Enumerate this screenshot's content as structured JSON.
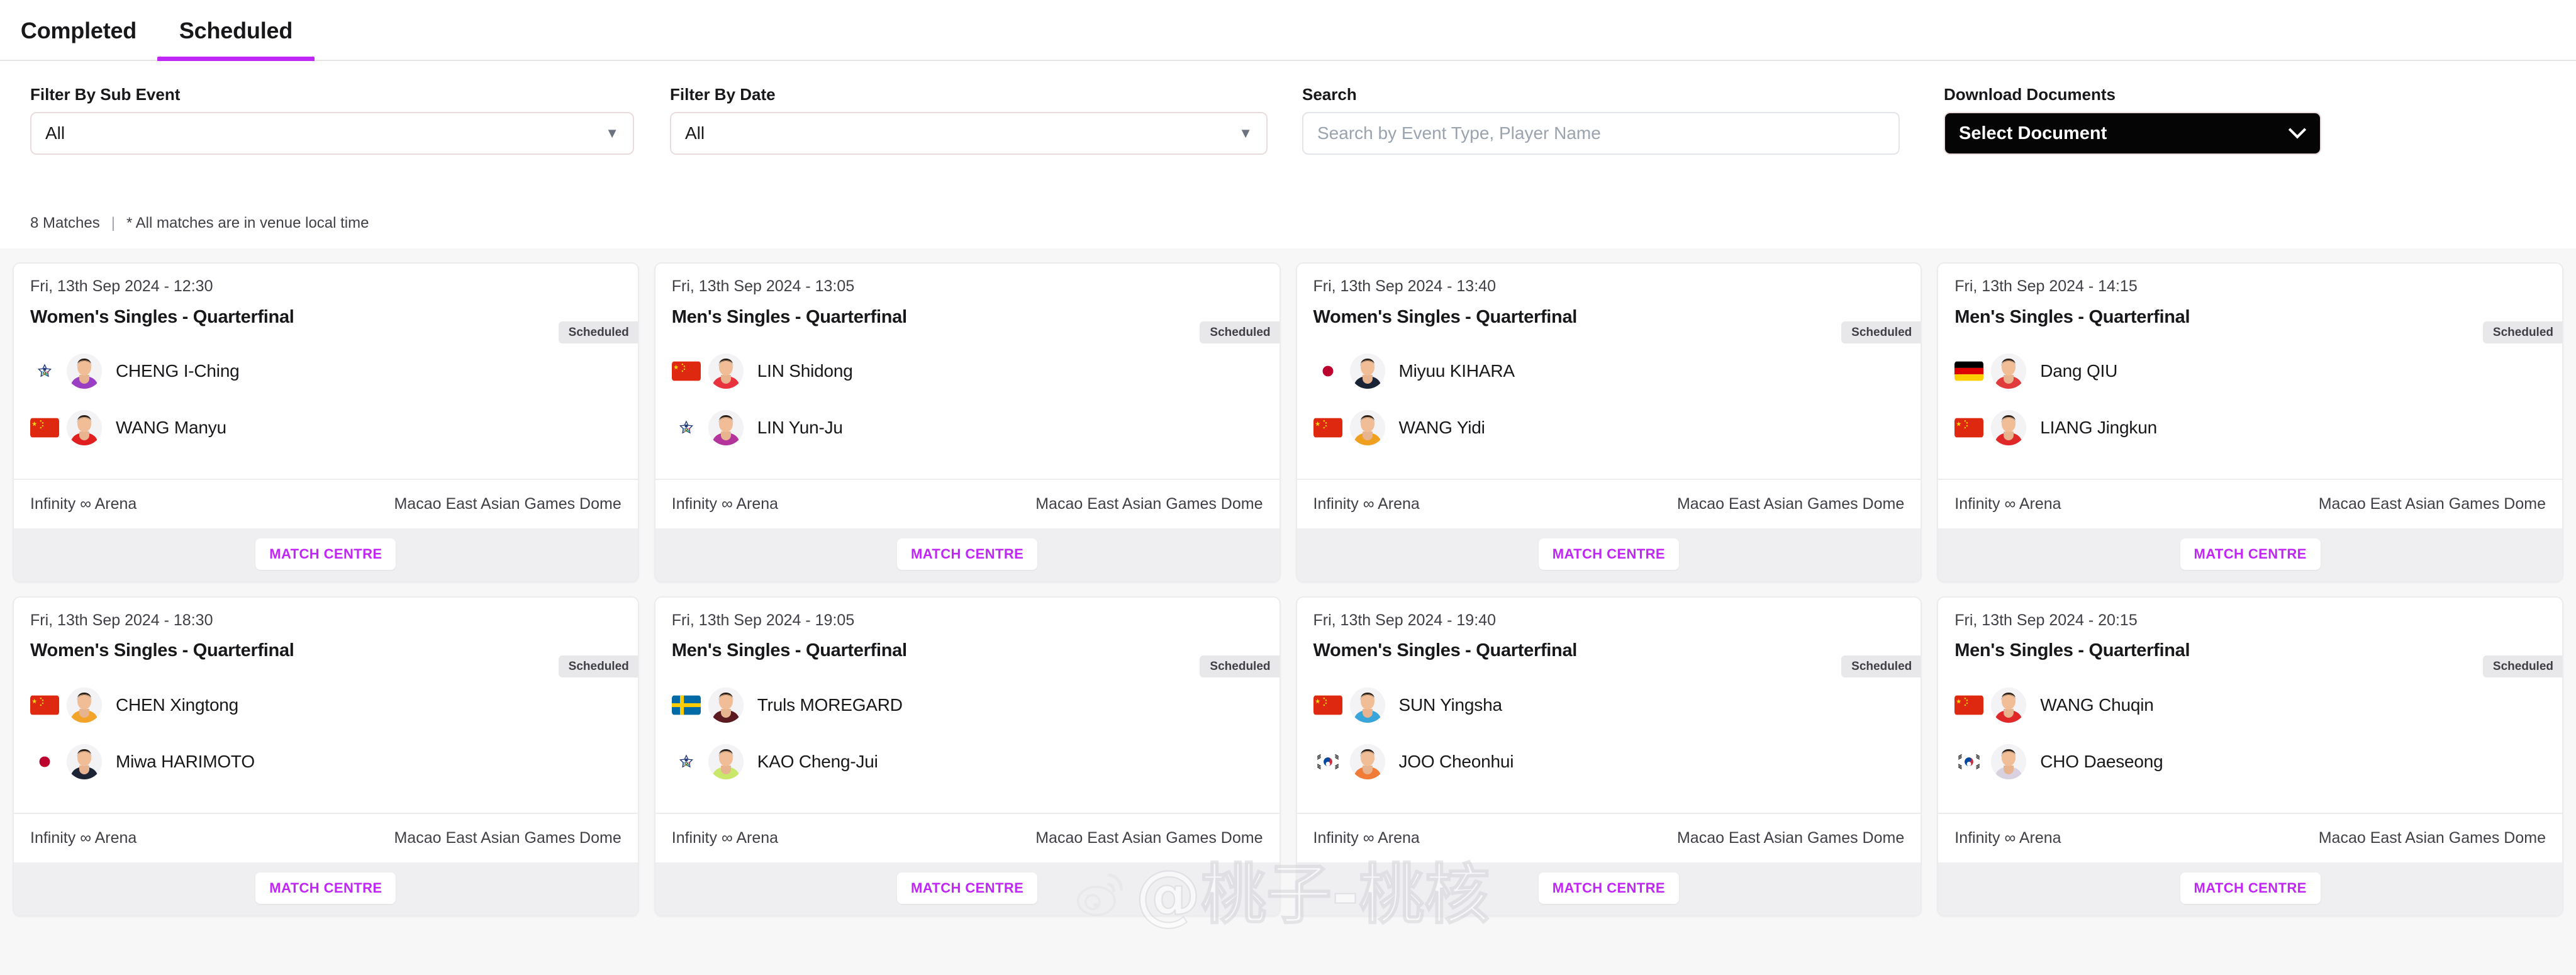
{
  "tabs": [
    {
      "label": "Completed",
      "active": false
    },
    {
      "label": "Scheduled",
      "active": true
    }
  ],
  "accent_color": "#c026f5",
  "filters": {
    "sub_event": {
      "label": "Filter By Sub Event",
      "value": "All"
    },
    "date": {
      "label": "Filter By Date",
      "value": "All"
    },
    "search": {
      "label": "Search",
      "value": "",
      "placeholder": "Search by Event Type, Player Name"
    },
    "documents": {
      "label": "Download Documents",
      "value": "Select Document"
    }
  },
  "meta": {
    "match_count": "8 Matches",
    "divider": "|",
    "note": "* All matches are in venue local time"
  },
  "match_centre_label": "MATCH CENTRE",
  "matches": [
    {
      "date": "Fri, 13th Sep 2024 - 12:30",
      "title": "Women's Singles - Quarterfinal",
      "status": "Scheduled",
      "venue_left": "Infinity ∞ Arena",
      "venue_right": "Macao East Asian Games Dome",
      "players": [
        {
          "name": "CHENG I-Ching",
          "flag": "tpe",
          "kit": "#9a3fc4"
        },
        {
          "name": "WANG Manyu",
          "flag": "cn",
          "kit": "#e02020"
        }
      ]
    },
    {
      "date": "Fri, 13th Sep 2024 - 13:05",
      "title": "Men's Singles - Quarterfinal",
      "status": "Scheduled",
      "venue_left": "Infinity ∞ Arena",
      "venue_right": "Macao East Asian Games Dome",
      "players": [
        {
          "name": "LIN Shidong",
          "flag": "cn",
          "kit": "#e8333f"
        },
        {
          "name": "LIN Yun-Ju",
          "flag": "tpe",
          "kit": "#b3359b"
        }
      ]
    },
    {
      "date": "Fri, 13th Sep 2024 - 13:40",
      "title": "Women's Singles - Quarterfinal",
      "status": "Scheduled",
      "venue_left": "Infinity ∞ Arena",
      "venue_right": "Macao East Asian Games Dome",
      "players": [
        {
          "name": "Miyuu KIHARA",
          "flag": "jp",
          "kit": "#1a2236"
        },
        {
          "name": "WANG Yidi",
          "flag": "cn",
          "kit": "#f0a020"
        }
      ]
    },
    {
      "date": "Fri, 13th Sep 2024 - 14:15",
      "title": "Men's Singles - Quarterfinal",
      "status": "Scheduled",
      "venue_left": "Infinity ∞ Arena",
      "venue_right": "Macao East Asian Games Dome",
      "players": [
        {
          "name": "Dang QIU",
          "flag": "de",
          "kit": "#e23b3b"
        },
        {
          "name": "LIANG Jingkun",
          "flag": "cn",
          "kit": "#e02828"
        }
      ]
    },
    {
      "date": "Fri, 13th Sep 2024 - 18:30",
      "title": "Women's Singles - Quarterfinal",
      "status": "Scheduled",
      "venue_left": "Infinity ∞ Arena",
      "venue_right": "Macao East Asian Games Dome",
      "players": [
        {
          "name": "CHEN Xingtong",
          "flag": "cn",
          "kit": "#f2a32a"
        },
        {
          "name": "Miwa HARIMOTO",
          "flag": "jp",
          "kit": "#1d2435"
        }
      ]
    },
    {
      "date": "Fri, 13th Sep 2024 - 19:05",
      "title": "Men's Singles - Quarterfinal",
      "status": "Scheduled",
      "venue_left": "Infinity ∞ Arena",
      "venue_right": "Macao East Asian Games Dome",
      "players": [
        {
          "name": "Truls MOREGARD",
          "flag": "se",
          "kit": "#5a1a1f"
        },
        {
          "name": "KAO Cheng-Jui",
          "flag": "tpe",
          "kit": "#c9e86a"
        }
      ]
    },
    {
      "date": "Fri, 13th Sep 2024 - 19:40",
      "title": "Women's Singles - Quarterfinal",
      "status": "Scheduled",
      "venue_left": "Infinity ∞ Arena",
      "venue_right": "Macao East Asian Games Dome",
      "players": [
        {
          "name": "SUN Yingsha",
          "flag": "cn",
          "kit": "#3aa5d8"
        },
        {
          "name": "JOO Cheonhui",
          "flag": "kr",
          "kit": "#f07c38"
        }
      ]
    },
    {
      "date": "Fri, 13th Sep 2024 - 20:15",
      "title": "Men's Singles - Quarterfinal",
      "status": "Scheduled",
      "venue_left": "Infinity ∞ Arena",
      "venue_right": "Macao East Asian Games Dome",
      "players": [
        {
          "name": "WANG Chuqin",
          "flag": "cn",
          "kit": "#e02828"
        },
        {
          "name": "CHO Daeseong",
          "flag": "kr",
          "kit": "#d8d2e0"
        }
      ]
    }
  ],
  "watermark": {
    "text": "@桃子-桃核",
    "logo": "weibo-logo"
  }
}
